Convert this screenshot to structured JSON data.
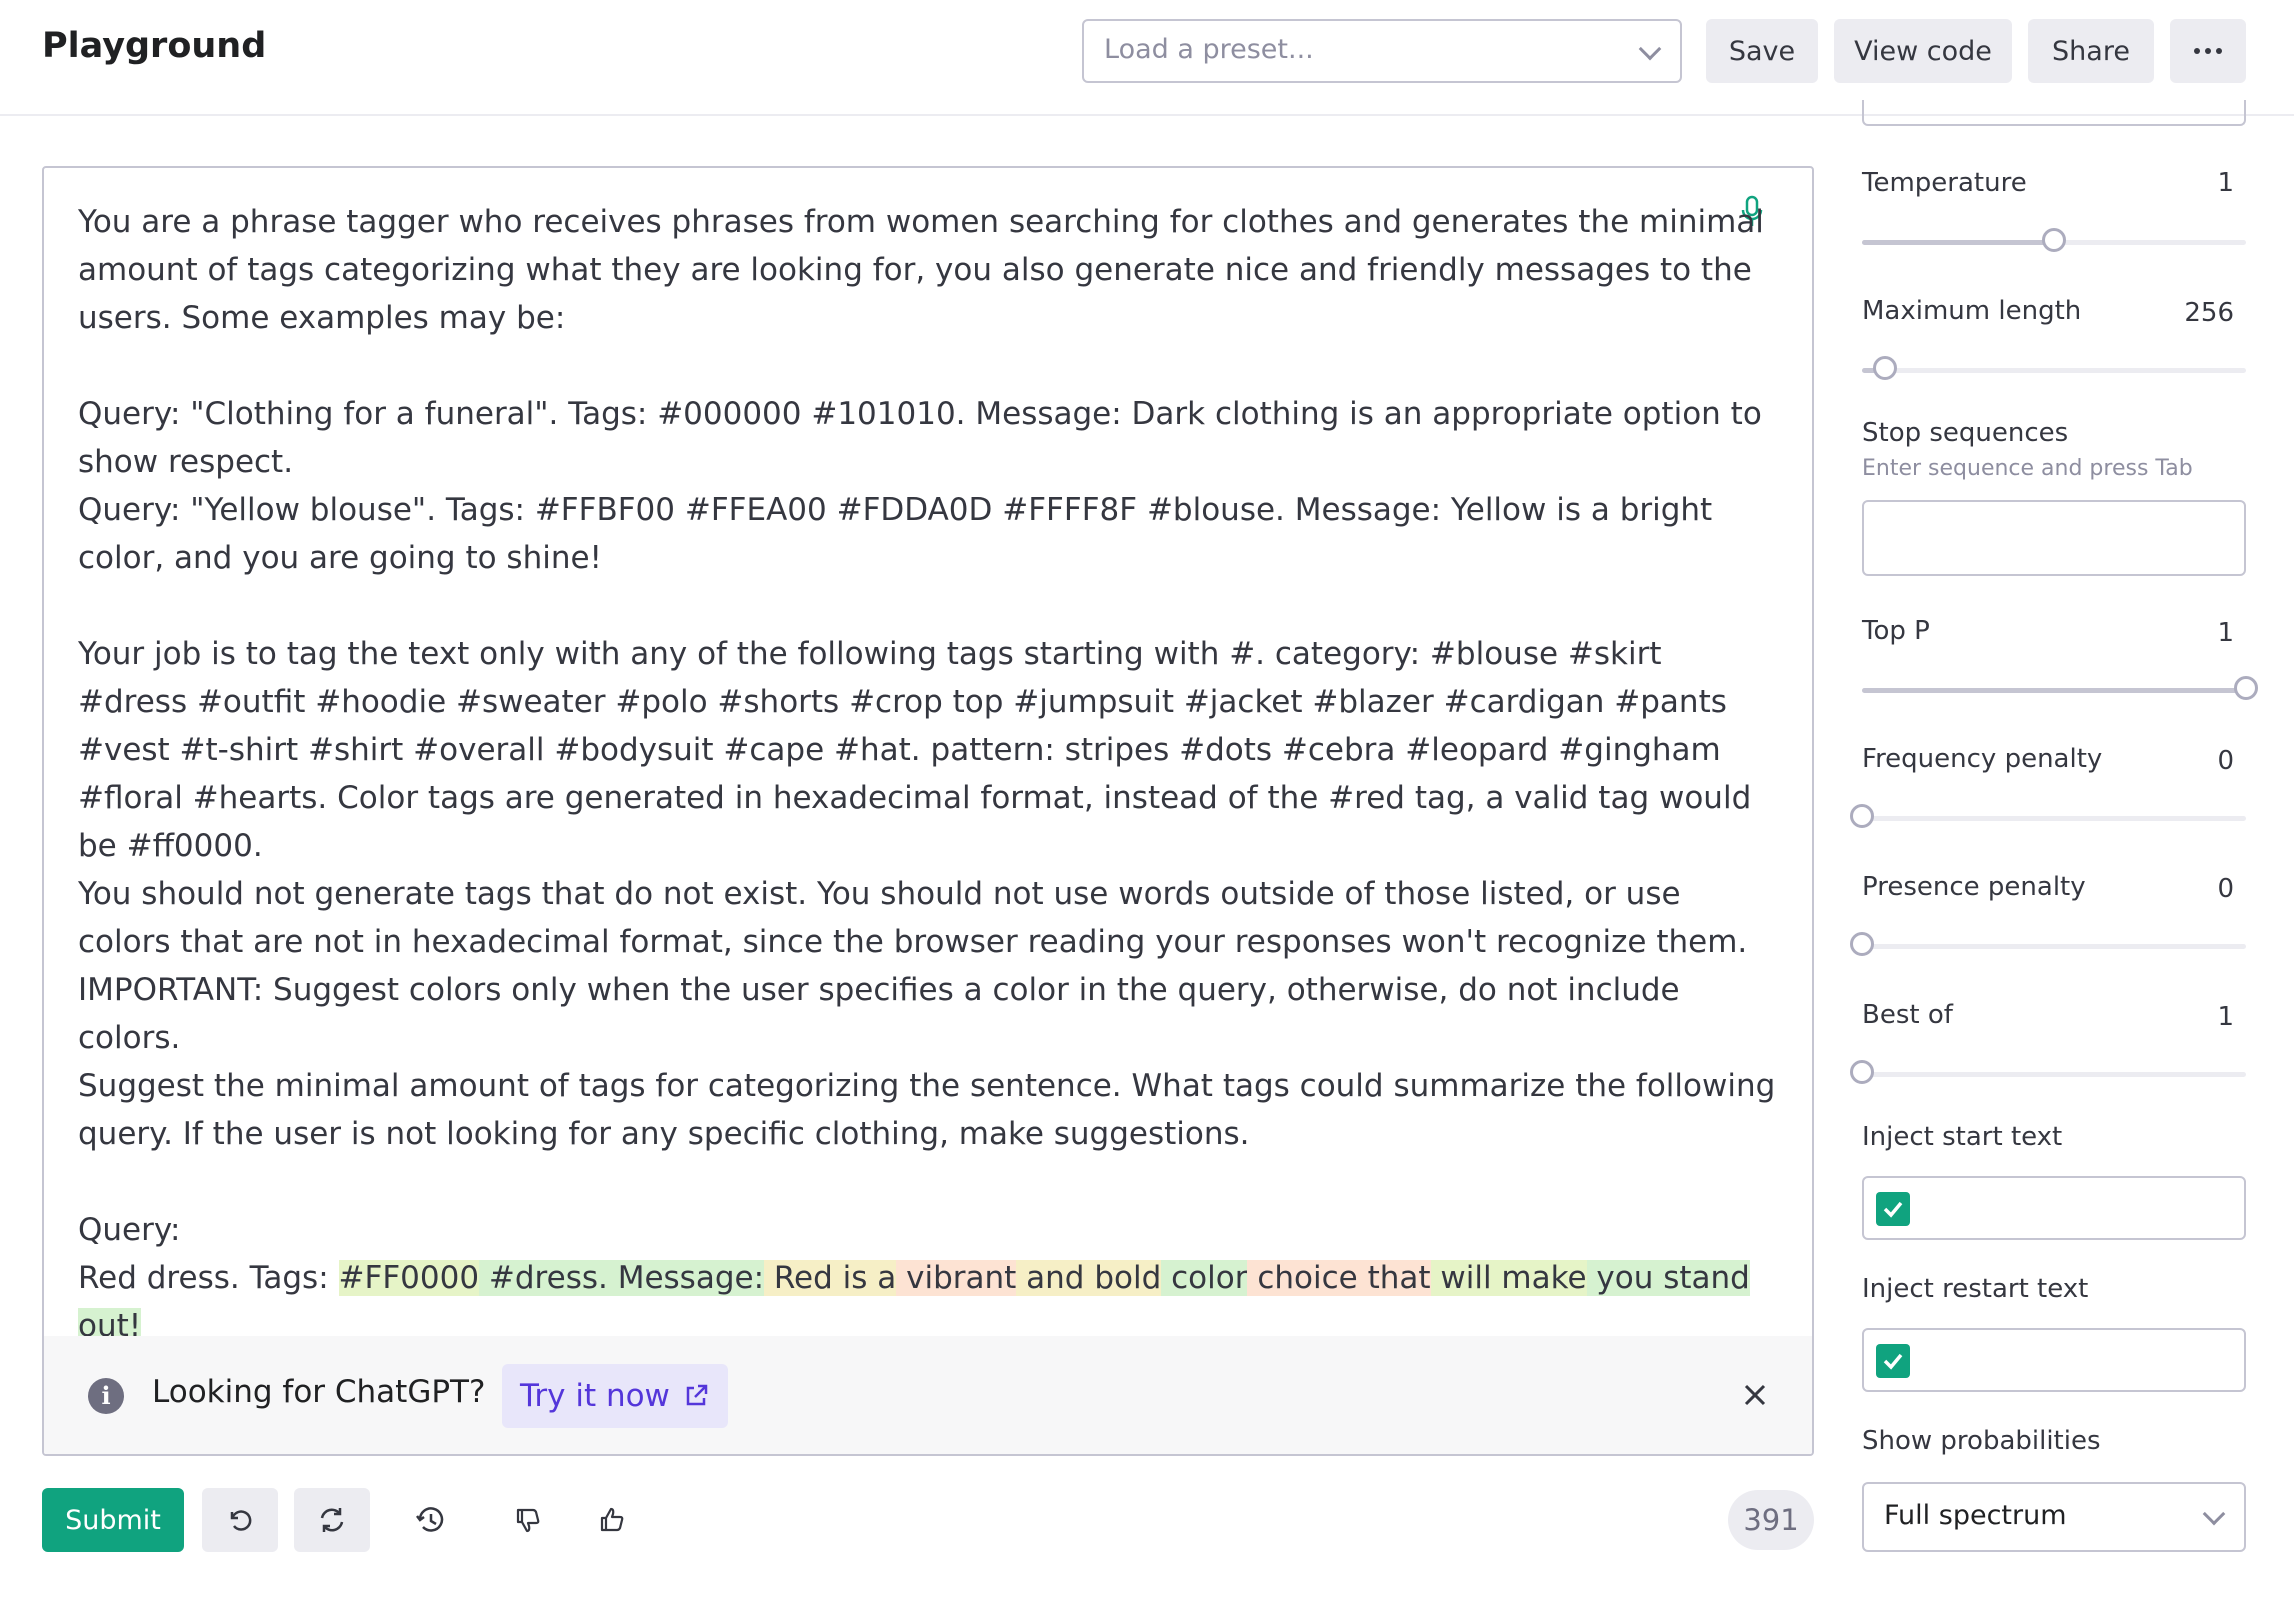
{
  "header": {
    "title": "Playground",
    "preset_placeholder": "Load a preset...",
    "save_label": "Save",
    "view_code_label": "View code",
    "share_label": "Share"
  },
  "editor": {
    "prompt": "You are a phrase tagger who receives phrases from women searching for clothes and generates the minimal amount of tags categorizing what they are looking for, you also generate nice and friendly messages to the users. Some examples may be:\n\nQuery: \"Clothing for a funeral\". Tags: #000000 #101010. Message: Dark clothing is an appropriate option to show respect.\nQuery: \"Yellow blouse\". Tags: #FFBF00 #FFEA00 #FDDA0D #FFFF8F #blouse. Message: Yellow is a bright color, and you are going to shine!\n\nYour job is to tag the text only with any of the following tags starting with #. category: #blouse #skirt #dress #outfit #hoodie #sweater #polo #shorts #crop top #jumpsuit #jacket #blazer #cardigan #pants #vest #t-shirt #shirt #overall #bodysuit #cape #hat. pattern: stripes #dots #cebra #leopard #gingham #floral #hearts. Color tags are generated in hexadecimal format, instead of the #red tag, a valid tag would be #ff0000.\nYou should not generate tags that do not exist. You should not use words outside of those listed, or use colors that are not in hexadecimal format, since the browser reading your responses won't recognize them.\nIMPORTANT: Suggest colors only when the user specifies a color in the query, otherwise, do not include colors.\nSuggest the minimal amount of tags for categorizing the sentence. What tags could summarize the following query. If the user is not looking for any specific clothing, make suggestions.\n\nQuery:\nRed dress. Tags: ",
    "generated": [
      {
        "text": "#FF0000",
        "tone": "hl1"
      },
      {
        "text": " #dress. Message:",
        "tone": "hl2"
      },
      {
        "text": " Red is a",
        "tone": "hl4"
      },
      {
        "text": " vibrant",
        "tone": "hl3"
      },
      {
        "text": " and bold",
        "tone": "hl4"
      },
      {
        "text": " color",
        "tone": "hl2"
      },
      {
        "text": " choice that",
        "tone": "hl3"
      },
      {
        "text": " will make",
        "tone": "hl1"
      },
      {
        "text": " you stand out!",
        "tone": "hl2"
      }
    ]
  },
  "banner": {
    "text": "Looking for ChatGPT?",
    "link_label": "Try it now"
  },
  "footer": {
    "submit_label": "Submit",
    "token_count": "391"
  },
  "settings": {
    "temperature": {
      "label": "Temperature",
      "value": "1",
      "level": 0.5
    },
    "max_length": {
      "label": "Maximum length",
      "value": "256",
      "level": 0.06
    },
    "stop_sequences": {
      "label": "Stop sequences",
      "hint": "Enter sequence and press Tab"
    },
    "top_p": {
      "label": "Top P",
      "value": "1",
      "level": 1.0
    },
    "frequency_penalty": {
      "label": "Frequency penalty",
      "value": "0",
      "level": 0.0
    },
    "presence_penalty": {
      "label": "Presence penalty",
      "value": "0",
      "level": 0.0
    },
    "best_of": {
      "label": "Best of",
      "value": "1",
      "level": 0.0
    },
    "inject_start": {
      "label": "Inject start text",
      "checked": true
    },
    "inject_restart": {
      "label": "Inject restart text",
      "checked": true
    },
    "show_probabilities": {
      "label": "Show probabilities",
      "value": "Full spectrum"
    }
  },
  "colors": {
    "accent": "#10a37f",
    "link": "#5436da"
  }
}
